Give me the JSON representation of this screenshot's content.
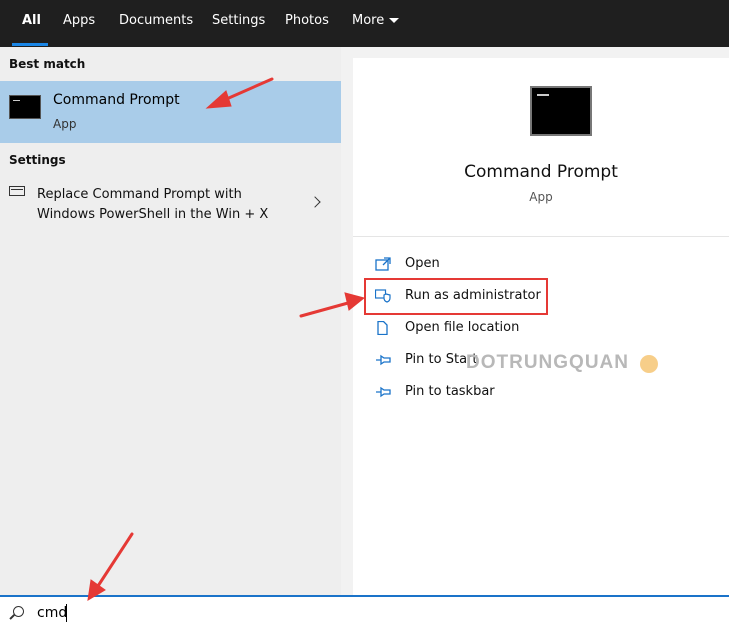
{
  "tabs": [
    {
      "label": "All",
      "active": true
    },
    {
      "label": "Apps"
    },
    {
      "label": "Documents"
    },
    {
      "label": "Settings"
    },
    {
      "label": "Photos"
    },
    {
      "label": "More"
    }
  ],
  "left": {
    "best_match_header": "Best match",
    "best_match": {
      "title": "Command Prompt",
      "subtitle": "App"
    },
    "settings_header": "Settings",
    "settings_item": {
      "line1": "Replace Command Prompt with",
      "line2": "Windows PowerShell in the Win + X"
    }
  },
  "right": {
    "title": "Command Prompt",
    "subtitle": "App",
    "actions": [
      {
        "label": "Open",
        "icon": "open-icon"
      },
      {
        "label": "Run as administrator",
        "icon": "shield-icon"
      },
      {
        "label": "Open file location",
        "icon": "file-icon"
      },
      {
        "label": "Pin to Start",
        "icon": "pin-icon"
      },
      {
        "label": "Pin to taskbar",
        "icon": "pin-icon"
      }
    ]
  },
  "watermark": "DOTRUNGQUAN",
  "search": {
    "value": "cmd"
  },
  "colors": {
    "accent": "#1a86e6",
    "highlight": "#a9cce9",
    "annotation": "#e53935",
    "topbar": "#1f1f1f"
  }
}
